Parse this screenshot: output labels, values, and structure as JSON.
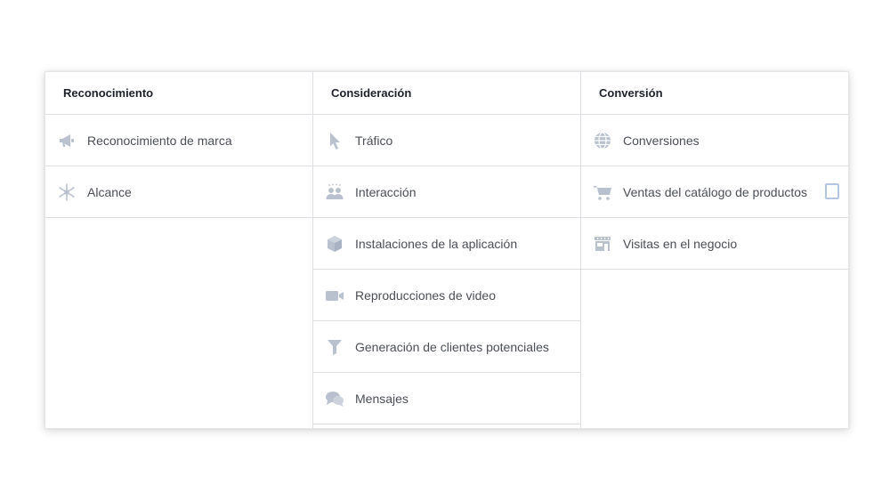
{
  "columns": [
    {
      "title": "Reconocimiento",
      "items": [
        {
          "label": "Reconocimiento de marca",
          "icon": "megaphone-icon"
        },
        {
          "label": "Alcance",
          "icon": "reach-icon"
        }
      ]
    },
    {
      "title": "Consideración",
      "items": [
        {
          "label": "Tráfico",
          "icon": "cursor-icon"
        },
        {
          "label": "Interacción",
          "icon": "people-icon"
        },
        {
          "label": "Instalaciones de la aplicación",
          "icon": "box-icon"
        },
        {
          "label": "Reproducciones de video",
          "icon": "video-camera-icon"
        },
        {
          "label": "Generación de clientes potenciales",
          "icon": "funnel-icon"
        },
        {
          "label": "Mensajes",
          "icon": "chat-bubbles-icon"
        }
      ]
    },
    {
      "title": "Conversión",
      "items": [
        {
          "label": "Conversiones",
          "icon": "globe-icon"
        },
        {
          "label": "Ventas del catálogo de productos",
          "icon": "shopping-cart-icon",
          "checkbox_checked": false
        },
        {
          "label": "Visitas en el negocio",
          "icon": "storefront-icon"
        }
      ]
    }
  ],
  "colors": {
    "icon": "#b9c1cf",
    "border": "#dddfe2",
    "heading_text": "#1d2129",
    "item_text": "#4b4f56",
    "checkbox_border": "#b4c6e4"
  }
}
